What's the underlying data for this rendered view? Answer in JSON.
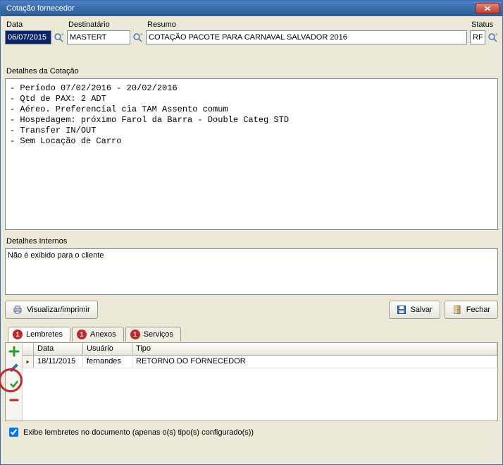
{
  "window": {
    "title": "Cotação fornecedor"
  },
  "header": {
    "data_label": "Data",
    "data_value": "06/07/2015",
    "dest_label": "Destinatário",
    "dest_value": "MASTERT",
    "resumo_label": "Resumo",
    "resumo_value": "COTAÇÃO PACOTE PARA CARNAVAL SALVADOR 2016",
    "status_label": "Status",
    "status_value": "RF"
  },
  "details": {
    "label": "Detalhes da Cotação",
    "text": "- Período 07/02/2016 - 20/02/2016\n- Qtd de PAX: 2 ADT\n- Aéreo. Preferencial cia TAM Assento comum\n- Hospedagem: próximo Farol da Barra - Double Categ STD\n- Transfer IN/OUT\n- Sem Locação de Carro"
  },
  "internal": {
    "label": "Detalhes Internos",
    "text": "Não é exibido para o cliente"
  },
  "actions": {
    "print": "Visualizar/imprimir",
    "save": "Salvar",
    "close": "Fechar"
  },
  "tabs": {
    "lembretes": {
      "label": "Lembretes",
      "badge": "1"
    },
    "anexos": {
      "label": "Anexos",
      "badge": "1"
    },
    "servicos": {
      "label": "Serviços",
      "badge": "1"
    }
  },
  "grid": {
    "columns": {
      "c1": "Data",
      "c2": "Usuário",
      "c3": "Tipo"
    },
    "rows": [
      {
        "data": "18/11/2015",
        "usuario": "fernandes",
        "tipo": "RETORNO DO FORNECEDOR"
      }
    ]
  },
  "checkbox": {
    "label": "Exibe lembretes no documento (apenas o(s) tipo(s) configurado(s))",
    "checked": true
  }
}
